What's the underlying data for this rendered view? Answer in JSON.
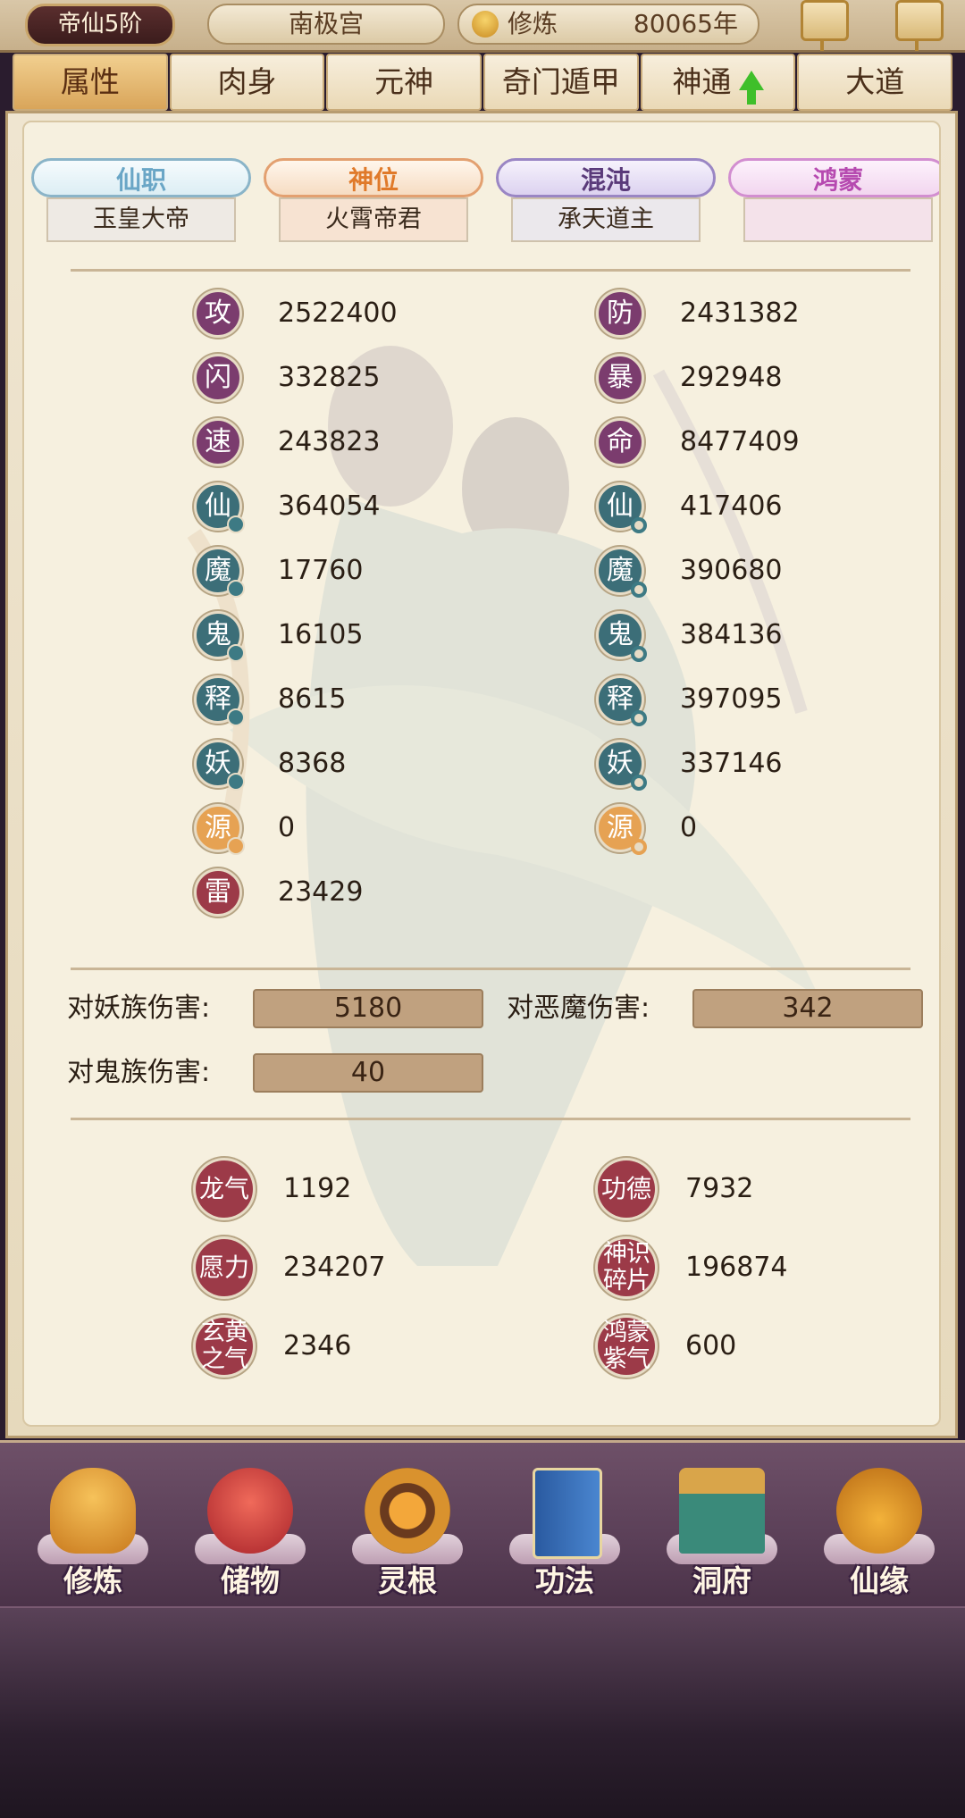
{
  "header": {
    "rank": "帝仙5阶",
    "palace": "南极宫",
    "cultivation_label": "修炼",
    "cultivation_value": "80065年"
  },
  "tabs": [
    {
      "label": "属性",
      "active": true
    },
    {
      "label": "肉身",
      "active": false
    },
    {
      "label": "元神",
      "active": false
    },
    {
      "label": "奇门遁甲",
      "active": false
    },
    {
      "label": "神通",
      "active": false
    },
    {
      "label": "大道",
      "active": false
    }
  ],
  "titles": [
    {
      "name": "仙职",
      "value": "玉皇大帝"
    },
    {
      "name": "神位",
      "value": "火霄帝君"
    },
    {
      "name": "混沌",
      "value": "承天道主"
    },
    {
      "name": "鸿蒙",
      "value": ""
    }
  ],
  "stats_left": [
    {
      "icon": "攻",
      "value": "2522400"
    },
    {
      "icon": "闪",
      "value": "332825"
    },
    {
      "icon": "速",
      "value": "243823"
    },
    {
      "icon": "仙",
      "value": "364054"
    },
    {
      "icon": "魔",
      "value": "17760"
    },
    {
      "icon": "鬼",
      "value": "16105"
    },
    {
      "icon": "释",
      "value": "8615"
    },
    {
      "icon": "妖",
      "value": "8368"
    },
    {
      "icon": "源",
      "value": "0"
    },
    {
      "icon": "雷",
      "value": "23429"
    }
  ],
  "stats_right": [
    {
      "icon": "防",
      "value": "2431382"
    },
    {
      "icon": "暴",
      "value": "292948"
    },
    {
      "icon": "命",
      "value": "8477409"
    },
    {
      "icon": "仙",
      "value": "417406"
    },
    {
      "icon": "魔",
      "value": "390680"
    },
    {
      "icon": "鬼",
      "value": "384136"
    },
    {
      "icon": "释",
      "value": "397095"
    },
    {
      "icon": "妖",
      "value": "337146"
    },
    {
      "icon": "源",
      "value": "0"
    }
  ],
  "damage": [
    {
      "label": "对妖族伤害:",
      "value": "5180"
    },
    {
      "label": "对恶魔伤害:",
      "value": "342"
    },
    {
      "label": "对鬼族伤害:",
      "value": "40"
    }
  ],
  "resources": [
    {
      "icon": "龙气",
      "value": "1192"
    },
    {
      "icon": "功德",
      "value": "7932"
    },
    {
      "icon": "愿力",
      "value": "234207"
    },
    {
      "icon": "神识碎片",
      "value": "196874"
    },
    {
      "icon": "玄黄之气",
      "value": "2346"
    },
    {
      "icon": "鸿蒙紫气",
      "value": "600"
    }
  ],
  "bottom_nav": [
    {
      "label": "修炼",
      "icon": "monk-icon"
    },
    {
      "label": "储物",
      "icon": "bag-icon"
    },
    {
      "label": "灵根",
      "icon": "spirit-root-icon"
    },
    {
      "label": "功法",
      "icon": "book-icon"
    },
    {
      "label": "洞府",
      "icon": "palace-icon"
    },
    {
      "label": "仙缘",
      "icon": "gourd-icon"
    }
  ],
  "colors": {
    "accent_tab": "#d9a55a",
    "stat_purple": "#7b3c6e",
    "stat_teal": "#3c6e78",
    "stat_orange": "#e6a253",
    "stat_red": "#9c3a48",
    "nav_bg": "#5a3f57"
  }
}
